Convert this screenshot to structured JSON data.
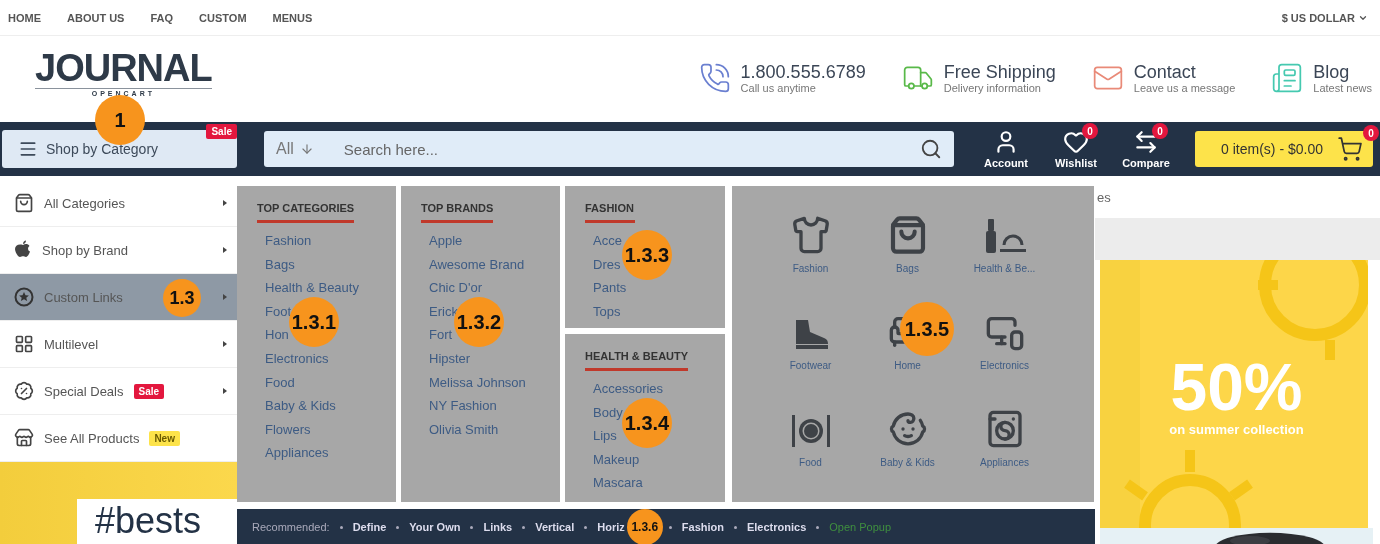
{
  "top_links": [
    {
      "label": "HOME"
    },
    {
      "label": "ABOUT US"
    },
    {
      "label": "FAQ"
    },
    {
      "label": "CUSTOM"
    },
    {
      "label": "MENUS"
    }
  ],
  "currency": "$ US DOLLAR",
  "logo": {
    "name": "JOURNAL",
    "tagline": "OPENCART"
  },
  "header_info": [
    {
      "title": "1.800.555.6789",
      "subtitle": "Call us anytime"
    },
    {
      "title": "Free Shipping",
      "subtitle": "Delivery information"
    },
    {
      "title": "Contact",
      "subtitle": "Leave us a message"
    },
    {
      "title": "Blog",
      "subtitle": "Latest news"
    }
  ],
  "category_button": {
    "label": "Shop by Category",
    "badge": "Sale",
    "callout": "1"
  },
  "search": {
    "scope": "All",
    "placeholder": "Search here..."
  },
  "header_actions": [
    {
      "label": "Account"
    },
    {
      "label": "Wishlist",
      "count": "0"
    },
    {
      "label": "Compare",
      "count": "0"
    }
  ],
  "cart": {
    "label": "0 item(s) - $0.00",
    "count": "0"
  },
  "category_menu": [
    {
      "label": "All Categories",
      "selected": false,
      "arrow": true
    },
    {
      "label": "Shop by Brand",
      "selected": false,
      "arrow": true
    },
    {
      "label": "Custom Links",
      "selected": true,
      "arrow": true,
      "callout": "1.3"
    },
    {
      "label": "Multilevel",
      "selected": false,
      "arrow": true
    },
    {
      "label": "Special Deals",
      "selected": false,
      "arrow": true,
      "badge": {
        "text": "Sale",
        "kind": "sale"
      }
    },
    {
      "label": "See All Products",
      "selected": false,
      "arrow": false,
      "badge": {
        "text": "New",
        "kind": "new"
      }
    }
  ],
  "mega_menu": {
    "columns": [
      {
        "kind": "links",
        "title": "TOP CATEGORIES",
        "callout": "1.3.1",
        "links": [
          "Fashion",
          "Bags",
          "Health & Beauty",
          "Foot",
          "Hon",
          "Electronics",
          "Food",
          "Baby & Kids",
          "Flowers",
          "Appliances"
        ]
      },
      {
        "kind": "links",
        "title": "TOP BRANDS",
        "callout": "1.3.2",
        "links": [
          "Apple",
          "Awesome Brand",
          "Chic D'or",
          "Erick",
          "Fort",
          "Hipster",
          "Melissa Johnson",
          "NY Fashion",
          "Olivia Smith"
        ]
      },
      {
        "kind": "stack",
        "sections": [
          {
            "title": "FASHION",
            "callout": "1.3.3",
            "links": [
              "Acce",
              "Dres",
              "Pants",
              "Tops"
            ]
          },
          {
            "title": "HEALTH & BEAUTY",
            "callout": "1.3.4",
            "links": [
              "Accessories",
              "Body",
              "Lips",
              "Makeup",
              "Mascara"
            ]
          }
        ]
      },
      {
        "kind": "tiles",
        "callout": "1.3.5",
        "tiles": [
          {
            "label": "Fashion"
          },
          {
            "label": "Bags"
          },
          {
            "label": "Health & Be..."
          },
          {
            "label": "Footwear"
          },
          {
            "label": "Home"
          },
          {
            "label": "Electronics"
          },
          {
            "label": "Food"
          },
          {
            "label": "Baby & Kids"
          },
          {
            "label": "Appliances"
          }
        ]
      }
    ],
    "recommended": {
      "label": "Recommended:",
      "links": [
        {
          "text": "Define"
        },
        {
          "text": "Your Own"
        },
        {
          "text": "Links"
        },
        {
          "text": "Vertical"
        },
        {
          "text": "Horiz",
          "callout": "1.3.6"
        },
        {
          "text": "Fashion"
        },
        {
          "text": "Electronics"
        }
      ],
      "popup": "Open Popup"
    }
  },
  "page_fragment": "es",
  "promo": {
    "headline": "50%",
    "caption": "on summer collection"
  },
  "banner_text": "#bests"
}
